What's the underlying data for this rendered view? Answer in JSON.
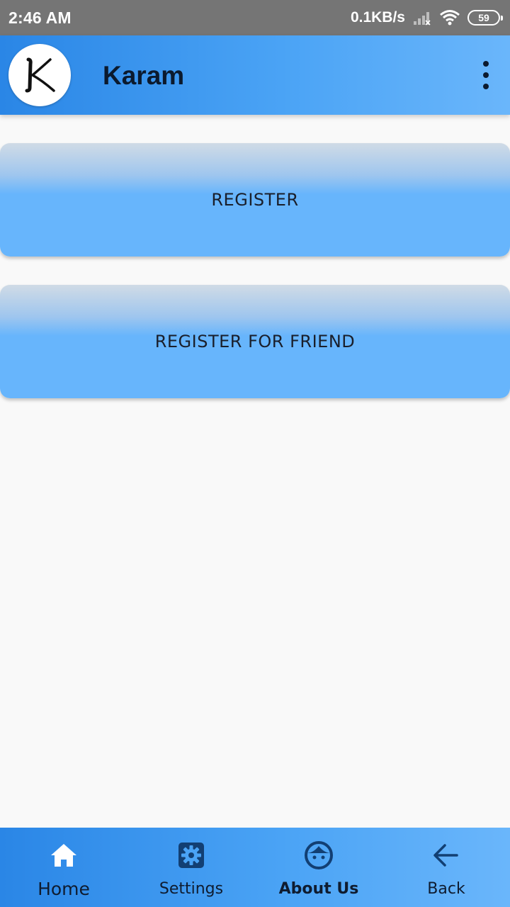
{
  "status_bar": {
    "time": "2:46 AM",
    "net_speed": "0.1KB/s",
    "battery": "59",
    "icons": [
      "signal-icon",
      "wifi-icon",
      "battery-icon"
    ]
  },
  "app_bar": {
    "logo_letter": "K",
    "title": "Karam",
    "menu_icon": "more-vert-icon",
    "gradient": [
      "#2a86e6",
      "#6ab6fb"
    ]
  },
  "main": {
    "buttons": [
      {
        "label": "REGISTER"
      },
      {
        "label": "REGISTER FOR FRIEND"
      }
    ]
  },
  "bottom_nav": {
    "items": [
      {
        "label": "Home",
        "icon": "home-icon"
      },
      {
        "label": "Settings",
        "icon": "settings-icon"
      },
      {
        "label": "About Us",
        "icon": "face-icon",
        "active": true
      },
      {
        "label": "Back",
        "icon": "arrow-back-icon"
      }
    ]
  }
}
